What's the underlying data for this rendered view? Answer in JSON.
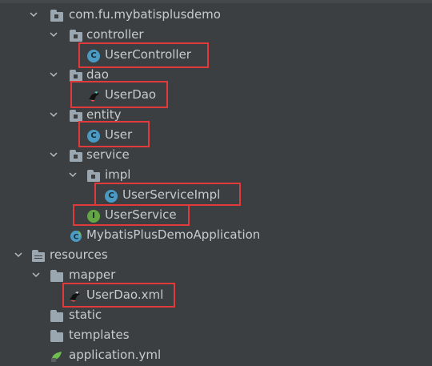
{
  "tree": {
    "package_root": "com.fu.mybatisplusdemo",
    "controller_folder": "controller",
    "user_controller": "UserController",
    "dao_folder": "dao",
    "user_dao": "UserDao",
    "entity_folder": "entity",
    "user_entity": "User",
    "service_folder": "service",
    "impl_folder": "impl",
    "user_service_impl": "UserServiceImpl",
    "user_service": "UserService",
    "application_class": "MybatisPlusDemoApplication",
    "resources_folder": "resources",
    "mapper_folder": "mapper",
    "user_dao_xml": "UserDao.xml",
    "static_folder": "static",
    "templates_folder": "templates",
    "application_yml": "application.yml"
  },
  "icons": {
    "class_badge": "C",
    "interface_badge": "I"
  },
  "colors": {
    "background": "#3c3f41",
    "text": "#c7cbcf",
    "highlight_border": "#e03a3a",
    "class_icon": "#4a9ac3",
    "interface_icon": "#62a744"
  }
}
